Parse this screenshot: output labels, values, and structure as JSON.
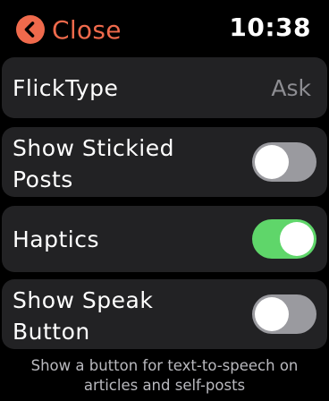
{
  "header": {
    "close_label": "Close",
    "close_icon": "chevron-left-icon",
    "time": "10:38"
  },
  "settings": {
    "flicktype": {
      "label": "FlickType",
      "value": "Ask"
    },
    "show_stickied": {
      "label_line1": "Show Stickied",
      "label_line2": "Posts",
      "enabled": false
    },
    "haptics": {
      "label": "Haptics",
      "enabled": true
    },
    "show_speak": {
      "label_line1": "Show Speak",
      "label_line2": "Button",
      "enabled": false
    }
  },
  "footer": {
    "line1": "Show a button for text-to-speech on",
    "line2": "articles and self-posts"
  },
  "colors": {
    "accent": "#ef6a4c",
    "row_bg": "#222224",
    "toggle_on": "#5fd66a",
    "toggle_off": "#9a9a9f",
    "secondary_text": "#8d8d92"
  }
}
